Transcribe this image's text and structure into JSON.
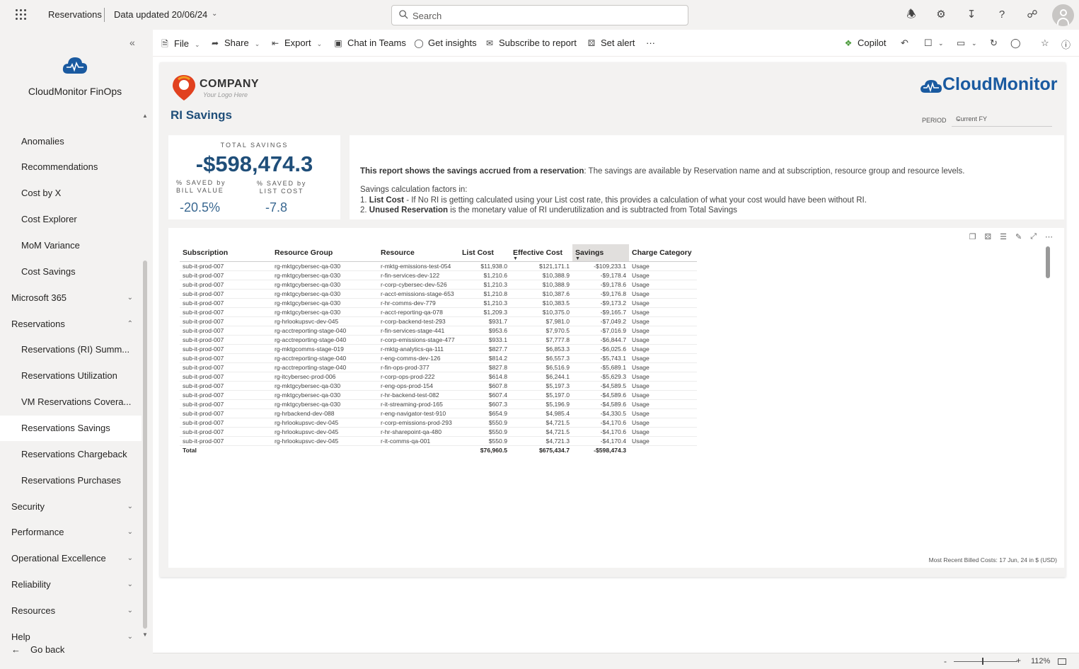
{
  "topbar": {
    "title": "Reservations",
    "updated": "Data updated 20/06/24",
    "search_placeholder": "Search"
  },
  "sidebar": {
    "brand": "CloudMonitor FinOps",
    "items": [
      {
        "label": "Anomalies",
        "level": "sub"
      },
      {
        "label": "Recommendations",
        "level": "sub"
      },
      {
        "label": "Cost by X",
        "level": "sub"
      },
      {
        "label": "Cost Explorer",
        "level": "sub"
      },
      {
        "label": "MoM Variance",
        "level": "sub"
      },
      {
        "label": "Cost Savings",
        "level": "sub"
      },
      {
        "label": "Microsoft 365",
        "level": "top",
        "chevron": "down"
      },
      {
        "label": "Reservations",
        "level": "top",
        "chevron": "up"
      },
      {
        "label": "Reservations (RI) Summ...",
        "level": "sub"
      },
      {
        "label": "Reservations Utilization",
        "level": "sub"
      },
      {
        "label": "VM Reservations Covera...",
        "level": "sub"
      },
      {
        "label": "Reservations Savings",
        "level": "sub",
        "active": true
      },
      {
        "label": "Reservations Chargeback",
        "level": "sub"
      },
      {
        "label": "Reservations Purchases",
        "level": "sub"
      },
      {
        "label": "Security",
        "level": "top",
        "chevron": "down"
      },
      {
        "label": "Performance",
        "level": "top",
        "chevron": "down"
      },
      {
        "label": "Operational Excellence",
        "level": "top",
        "chevron": "down"
      },
      {
        "label": "Reliability",
        "level": "top",
        "chevron": "down"
      },
      {
        "label": "Resources",
        "level": "top",
        "chevron": "down"
      },
      {
        "label": "Help",
        "level": "top",
        "chevron": "down"
      }
    ],
    "go_back": "Go back"
  },
  "commands": {
    "file": "File",
    "share": "Share",
    "export": "Export",
    "chat": "Chat in Teams",
    "insights": "Get insights",
    "subscribe": "Subscribe to report",
    "alert": "Set alert",
    "more": "···",
    "copilot": "Copilot"
  },
  "report": {
    "company_name": "COMPANY",
    "company_tagline": "Your Logo Here",
    "cm_brand": "CloudMonitor",
    "title": "RI Savings",
    "period_label": "PERIOD",
    "period_value": "Current FY",
    "kpi": {
      "total_label": "TOTAL SAVINGS",
      "total_value": "-$598,474.3",
      "bill_label": "% SAVED by BILL VALUE",
      "bill_value": "-20.5%",
      "list_label": "% SAVED by LIST COST",
      "list_value": "-7.8"
    },
    "description": {
      "line1_bold": "This report shows the savings accrued from a reservation",
      "line1_rest": ": The savings are available by Reservation name and at subscription, resource group and resource levels.",
      "line2": "Savings calculation factors in:",
      "line3_num": "1. ",
      "line3_bold": "List Cost",
      "line3_rest": " - If No RI is getting calculated using your List cost rate, this provides a calculation of what your cost would have been without RI.",
      "line4_num": "2. ",
      "line4_bold": "Unused Reservation",
      "line4_rest": " is the monetary value of RI underutilization and is subtracted from Total Savings"
    },
    "table": {
      "columns": [
        "Subscription",
        "Resource Group",
        "Resource",
        "List Cost",
        "Effective Cost",
        "Savings",
        "Charge Category"
      ],
      "rows": [
        [
          "sub-it-prod-007",
          "rg-mktgcybersec-qa-030",
          "r-mktg-emissions-test-054",
          "$11,938.0",
          "$121,171.1",
          "-$109,233.1",
          "Usage"
        ],
        [
          "sub-it-prod-007",
          "rg-mktgcybersec-qa-030",
          "r-fin-services-dev-122",
          "$1,210.6",
          "$10,388.9",
          "-$9,178.4",
          "Usage"
        ],
        [
          "sub-it-prod-007",
          "rg-mktgcybersec-qa-030",
          "r-corp-cybersec-dev-526",
          "$1,210.3",
          "$10,388.9",
          "-$9,178.6",
          "Usage"
        ],
        [
          "sub-it-prod-007",
          "rg-mktgcybersec-qa-030",
          "r-acct-emissions-stage-653",
          "$1,210.8",
          "$10,387.6",
          "-$9,176.8",
          "Usage"
        ],
        [
          "sub-it-prod-007",
          "rg-mktgcybersec-qa-030",
          "r-hr-comms-dev-779",
          "$1,210.3",
          "$10,383.5",
          "-$9,173.2",
          "Usage"
        ],
        [
          "sub-it-prod-007",
          "rg-mktgcybersec-qa-030",
          "r-acct-reporting-qa-078",
          "$1,209.3",
          "$10,375.0",
          "-$9,165.7",
          "Usage"
        ],
        [
          "sub-it-prod-007",
          "rg-hrlookupsvc-dev-045",
          "r-corp-backend-test-293",
          "$931.7",
          "$7,981.0",
          "-$7,049.2",
          "Usage"
        ],
        [
          "sub-it-prod-007",
          "rg-acctreporting-stage-040",
          "r-fin-services-stage-441",
          "$953.6",
          "$7,970.5",
          "-$7,016.9",
          "Usage"
        ],
        [
          "sub-it-prod-007",
          "rg-acctreporting-stage-040",
          "r-corp-emissions-stage-477",
          "$933.1",
          "$7,777.8",
          "-$6,844.7",
          "Usage"
        ],
        [
          "sub-it-prod-007",
          "rg-mktgcomms-stage-019",
          "r-mktg-analytics-qa-111",
          "$827.7",
          "$6,853.3",
          "-$6,025.6",
          "Usage"
        ],
        [
          "sub-it-prod-007",
          "rg-acctreporting-stage-040",
          "r-eng-comms-dev-126",
          "$814.2",
          "$6,557.3",
          "-$5,743.1",
          "Usage"
        ],
        [
          "sub-it-prod-007",
          "rg-acctreporting-stage-040",
          "r-fin-ops-prod-377",
          "$827.8",
          "$6,516.9",
          "-$5,689.1",
          "Usage"
        ],
        [
          "sub-it-prod-007",
          "rg-itcybersec-prod-006",
          "r-corp-ops-prod-222",
          "$614.8",
          "$6,244.1",
          "-$5,629.3",
          "Usage"
        ],
        [
          "sub-it-prod-007",
          "rg-mktgcybersec-qa-030",
          "r-eng-ops-prod-154",
          "$607.8",
          "$5,197.3",
          "-$4,589.5",
          "Usage"
        ],
        [
          "sub-it-prod-007",
          "rg-mktgcybersec-qa-030",
          "r-hr-backend-test-082",
          "$607.4",
          "$5,197.0",
          "-$4,589.6",
          "Usage"
        ],
        [
          "sub-it-prod-007",
          "rg-mktgcybersec-qa-030",
          "r-it-streaming-prod-165",
          "$607.3",
          "$5,196.9",
          "-$4,589.6",
          "Usage"
        ],
        [
          "sub-it-prod-007",
          "rg-hrbackend-dev-088",
          "r-eng-navigator-test-910",
          "$654.9",
          "$4,985.4",
          "-$4,330.5",
          "Usage"
        ],
        [
          "sub-it-prod-007",
          "rg-hrlookupsvc-dev-045",
          "r-corp-emissions-prod-293",
          "$550.9",
          "$4,721.5",
          "-$4,170.6",
          "Usage"
        ],
        [
          "sub-it-prod-007",
          "rg-hrlookupsvc-dev-045",
          "r-hr-sharepoint-qa-480",
          "$550.9",
          "$4,721.5",
          "-$4,170.6",
          "Usage"
        ],
        [
          "sub-it-prod-007",
          "rg-hrlookupsvc-dev-045",
          "r-it-comms-qa-001",
          "$550.9",
          "$4,721.3",
          "-$4,170.4",
          "Usage"
        ]
      ],
      "total": [
        "Total",
        "",
        "",
        "$76,960.5",
        "$675,434.7",
        "-$598,474.3",
        ""
      ]
    },
    "footnote": "Most Recent Billed Costs: 17 Jun, 24 in $ (USD)"
  },
  "status": {
    "zoom": "112%"
  },
  "colors": {
    "accent": "#1f4e79",
    "brand": "#1a5aa0"
  }
}
